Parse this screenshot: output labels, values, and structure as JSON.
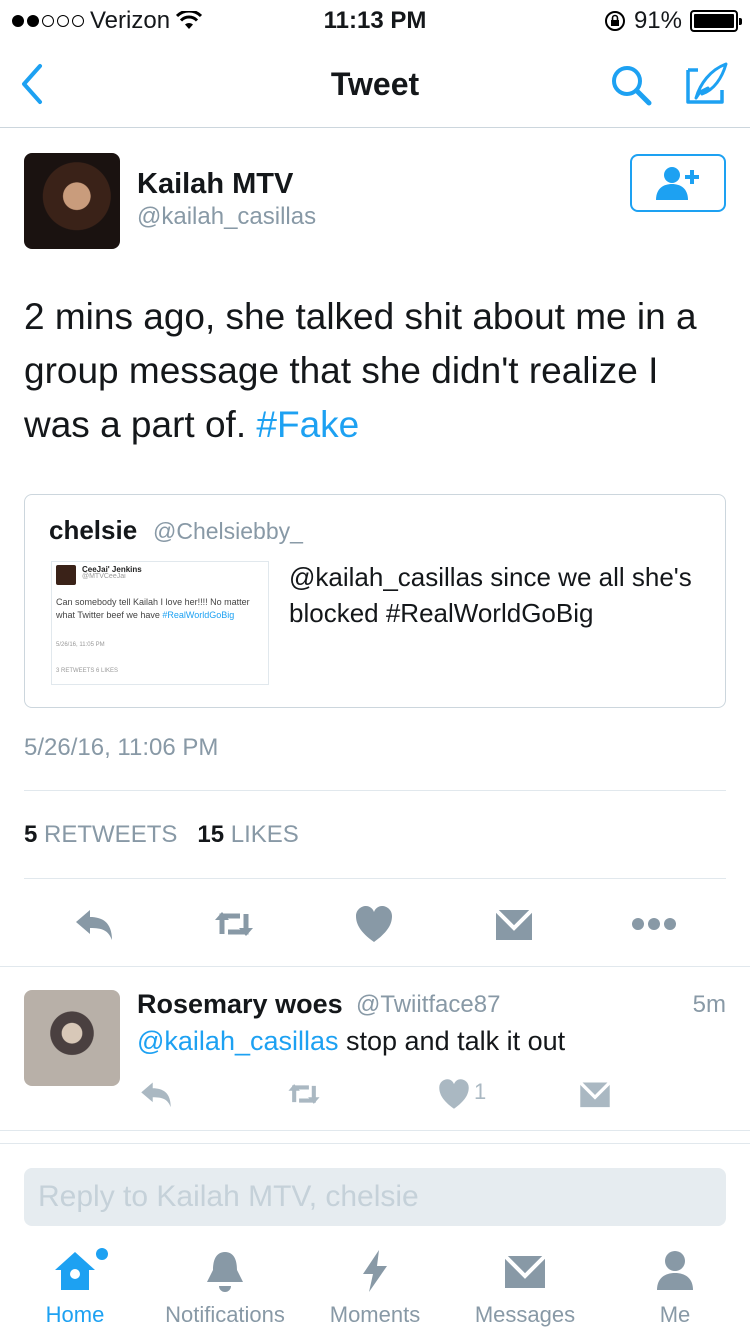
{
  "status_bar": {
    "carrier": "Verizon",
    "time": "11:13 PM",
    "battery": "91%",
    "battery_level": 0.91
  },
  "nav": {
    "title": "Tweet"
  },
  "tweet": {
    "author_name": "Kailah MTV",
    "author_handle": "@kailah_casillas",
    "text": "2 mins ago, she talked shit about me in a group message that she didn't realize I was a part of. ",
    "hashtag": "#Fake",
    "timestamp": "5/26/16, 11:06 PM",
    "retweets_count": "5",
    "retweets_label": "RETWEETS",
    "likes_count": "15",
    "likes_label": "LIKES"
  },
  "quoted": {
    "name": "chelsie",
    "handle": "@Chelsiebby_",
    "text": "@kailah_casillas since we all she's blocked #RealWorldGoBig",
    "image": {
      "name": "CeeJai' Jenkins",
      "handle": "@MTVCeeJai",
      "text": "Can somebody tell Kailah I love her!!!! No matter what Twitter beef we have ",
      "tag": "#RealWorldGoBig",
      "date": "5/26/16, 11:05 PM",
      "stats": "3 RETWEETS  6 LIKES"
    }
  },
  "reply": {
    "name": "Rosemary woes",
    "handle": "@Twiitface87",
    "time": "5m",
    "mention": "@kailah_casillas",
    "text": " stop and talk it out",
    "likes": "1"
  },
  "reply_box": {
    "placeholder": "Reply to Kailah MTV, chelsie"
  },
  "tabs": [
    {
      "label": "Home",
      "icon": "home-icon",
      "active": true
    },
    {
      "label": "Notifications",
      "icon": "bell-icon"
    },
    {
      "label": "Moments",
      "icon": "lightning-icon"
    },
    {
      "label": "Messages",
      "icon": "envelope-icon"
    },
    {
      "label": "Me",
      "icon": "person-icon"
    }
  ],
  "colors": {
    "accent": "#1da1f2",
    "muted": "#8899a6",
    "icon": "#aab8c2"
  }
}
